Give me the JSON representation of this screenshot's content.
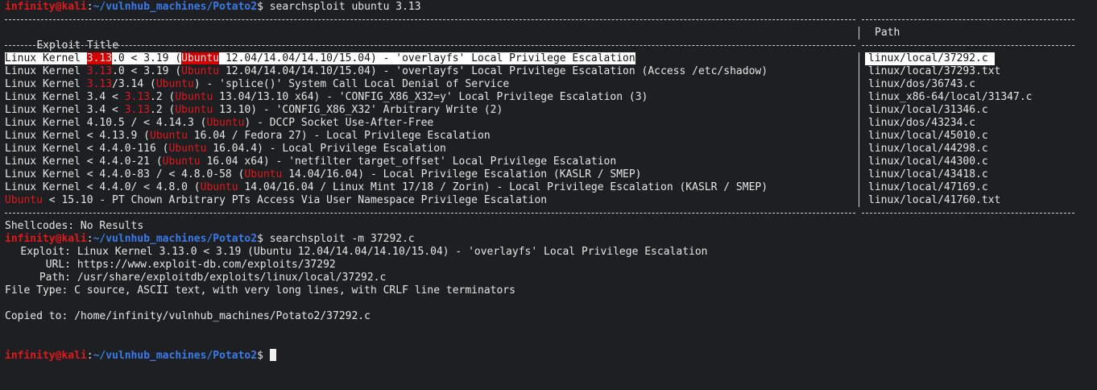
{
  "prompt": {
    "user": "infinity@kali",
    "colon": ":",
    "path": "~/vulnhub_machines/Potato2",
    "dollar": "$"
  },
  "commands": {
    "first": "searchsploit ubuntu 3.13",
    "second": "searchsploit -m 37292.c"
  },
  "table": {
    "header_title": "Exploit Title",
    "header_path": "Path",
    "rows": [
      {
        "title": [
          {
            "t": "Linux Kernel "
          },
          {
            "t": "3.13",
            "h": 1
          },
          {
            "t": ".0 < 3.19 ("
          },
          {
            "t": "Ubuntu",
            "h": 1
          },
          {
            "t": " 12.04/14.04/14.10/15.04) - 'overlayfs' Local Privilege Escalation"
          }
        ],
        "path": "linux/local/37292.c",
        "selected": true
      },
      {
        "title": [
          {
            "t": "Linux Kernel "
          },
          {
            "t": "3.13",
            "h": 1
          },
          {
            "t": ".0 < 3.19 ("
          },
          {
            "t": "Ubuntu",
            "h": 1
          },
          {
            "t": " 12.04/14.04/14.10/15.04) - 'overlayfs' Local Privilege Escalation (Access /etc/shadow)"
          }
        ],
        "path": "linux/local/37293.txt"
      },
      {
        "title": [
          {
            "t": "Linux Kernel "
          },
          {
            "t": "3.13",
            "h": 1
          },
          {
            "t": "/3.14 ("
          },
          {
            "t": "Ubuntu",
            "h": 1
          },
          {
            "t": ") - 'splice()' System Call Local Denial of Service"
          }
        ],
        "path": "linux/dos/36743.c"
      },
      {
        "title": [
          {
            "t": "Linux Kernel 3.4 < "
          },
          {
            "t": "3.13",
            "h": 1
          },
          {
            "t": ".2 ("
          },
          {
            "t": "Ubuntu",
            "h": 1
          },
          {
            "t": " 13.04/13.10 x64) - 'CONFIG_X86_X32=y' Local Privilege Escalation (3)"
          }
        ],
        "path": "linux_x86-64/local/31347.c"
      },
      {
        "title": [
          {
            "t": "Linux Kernel 3.4 < "
          },
          {
            "t": "3.13",
            "h": 1
          },
          {
            "t": ".2 ("
          },
          {
            "t": "Ubuntu",
            "h": 1
          },
          {
            "t": " 13.10) - 'CONFIG_X86_X32' Arbitrary Write (2)"
          }
        ],
        "path": "linux/local/31346.c"
      },
      {
        "title": [
          {
            "t": "Linux Kernel 4.10.5 / < 4.14.3 ("
          },
          {
            "t": "Ubuntu",
            "h": 1
          },
          {
            "t": ") - DCCP Socket Use-After-Free"
          }
        ],
        "path": "linux/dos/43234.c"
      },
      {
        "title": [
          {
            "t": "Linux Kernel < 4.13.9 ("
          },
          {
            "t": "Ubuntu",
            "h": 1
          },
          {
            "t": " 16.04 / Fedora 27) - Local Privilege Escalation"
          }
        ],
        "path": "linux/local/45010.c"
      },
      {
        "title": [
          {
            "t": "Linux Kernel < 4.4.0-116 ("
          },
          {
            "t": "Ubuntu",
            "h": 1
          },
          {
            "t": " 16.04.4) - Local Privilege Escalation"
          }
        ],
        "path": "linux/local/44298.c"
      },
      {
        "title": [
          {
            "t": "Linux Kernel < 4.4.0-21 ("
          },
          {
            "t": "Ubuntu",
            "h": 1
          },
          {
            "t": " 16.04 x64) - 'netfilter target_offset' Local Privilege Escalation"
          }
        ],
        "path": "linux/local/44300.c"
      },
      {
        "title": [
          {
            "t": "Linux Kernel < 4.4.0-83 / < 4.8.0-58 ("
          },
          {
            "t": "Ubuntu",
            "h": 1
          },
          {
            "t": " 14.04/16.04) - Local Privilege Escalation (KASLR / SMEP)"
          }
        ],
        "path": "linux/local/43418.c"
      },
      {
        "title": [
          {
            "t": "Linux Kernel < 4.4.0/ < 4.8.0 ("
          },
          {
            "t": "Ubuntu",
            "h": 1
          },
          {
            "t": " 14.04/16.04 / Linux Mint 17/18 / Zorin) - Local Privilege Escalation (KASLR / SMEP)"
          }
        ],
        "path": "linux/local/47169.c"
      },
      {
        "title": [
          {
            "t": "Ubuntu",
            "h": 1
          },
          {
            "t": " < 15.10 - PT Chown Arbitrary PTs Access Via User Namespace Privilege Escalation"
          }
        ],
        "path": "linux/local/41760.txt"
      }
    ]
  },
  "shellcodes": "Shellcodes: No Results",
  "mirror": {
    "exploit_label": "Exploit:",
    "exploit_value": "Linux Kernel 3.13.0 < 3.19 (Ubuntu 12.04/14.04/14.10/15.04) - 'overlayfs' Local Privilege Escalation",
    "url_label": "URL:",
    "url_value": "https://www.exploit-db.com/exploits/37292",
    "path_label": "Path:",
    "path_value": "/usr/share/exploitdb/exploits/linux/local/37292.c",
    "filetype": "File Type: C source, ASCII text, with very long lines, with CRLF line terminators",
    "copied": "Copied to: /home/infinity/vulnhub_machines/Potato2/37292.c"
  },
  "colors": {
    "background": "#1d1f23",
    "user": "#e0191b",
    "path": "#3b7be8",
    "highlight": "#e0191b",
    "text": "#e6e6e6"
  }
}
